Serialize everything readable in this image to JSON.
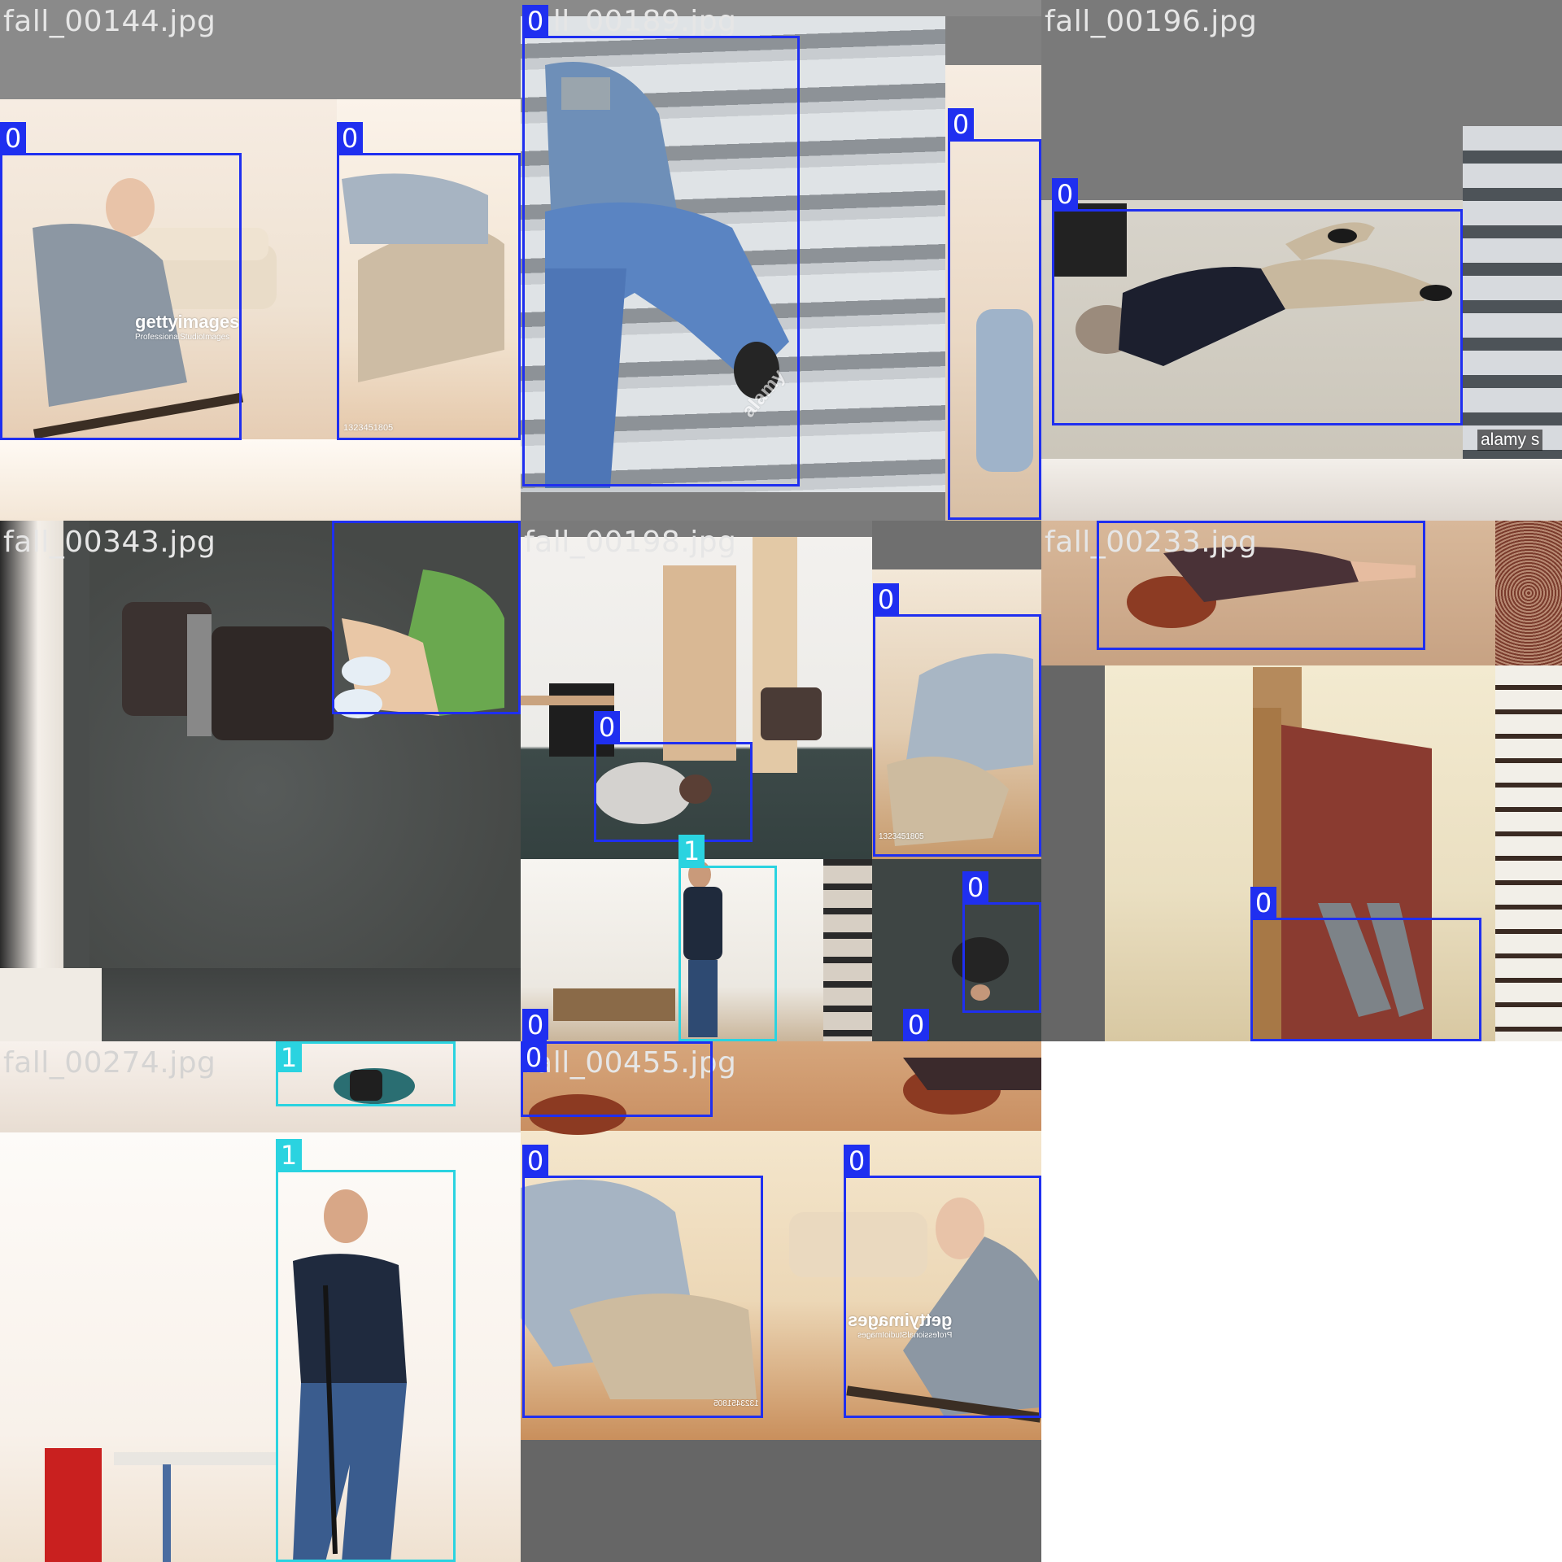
{
  "colors": {
    "class_0": "#1f2ff0",
    "class_1": "#2ad3e0",
    "filename_text": "#e6e6e6",
    "padding_gray": "#7a7a7a"
  },
  "tiles": [
    {
      "filename": "fall_00144.jpg",
      "watermarks": [
        "gettyimages",
        "ProfessionalStudioImages",
        "1323451805"
      ],
      "labels": [
        "0",
        "0"
      ]
    },
    {
      "filename": "fall_00189.jpg",
      "watermarks": [
        "alamy"
      ],
      "labels": [
        "0",
        "0"
      ]
    },
    {
      "filename": "fall_00196.jpg",
      "watermarks": [
        "alamy s"
      ],
      "labels": [
        "0"
      ]
    },
    {
      "filename": "fall_00343.jpg",
      "labels": [
        "0"
      ]
    },
    {
      "filename": "fall_00198.jpg",
      "watermarks": [
        "1323451805"
      ],
      "labels": [
        "0",
        "0",
        "1",
        "0",
        "0",
        "0"
      ]
    },
    {
      "filename": "fall_00233.jpg",
      "labels": [
        "0",
        "0"
      ]
    },
    {
      "filename": "fall_00274.jpg",
      "labels": [
        "1",
        "1"
      ]
    },
    {
      "filename": "fall_00455.jpg",
      "watermarks": [
        "gettyimages",
        "ProfessionalStudioImages",
        "1323451805"
      ],
      "labels": [
        "0",
        "0",
        "0"
      ]
    }
  ]
}
